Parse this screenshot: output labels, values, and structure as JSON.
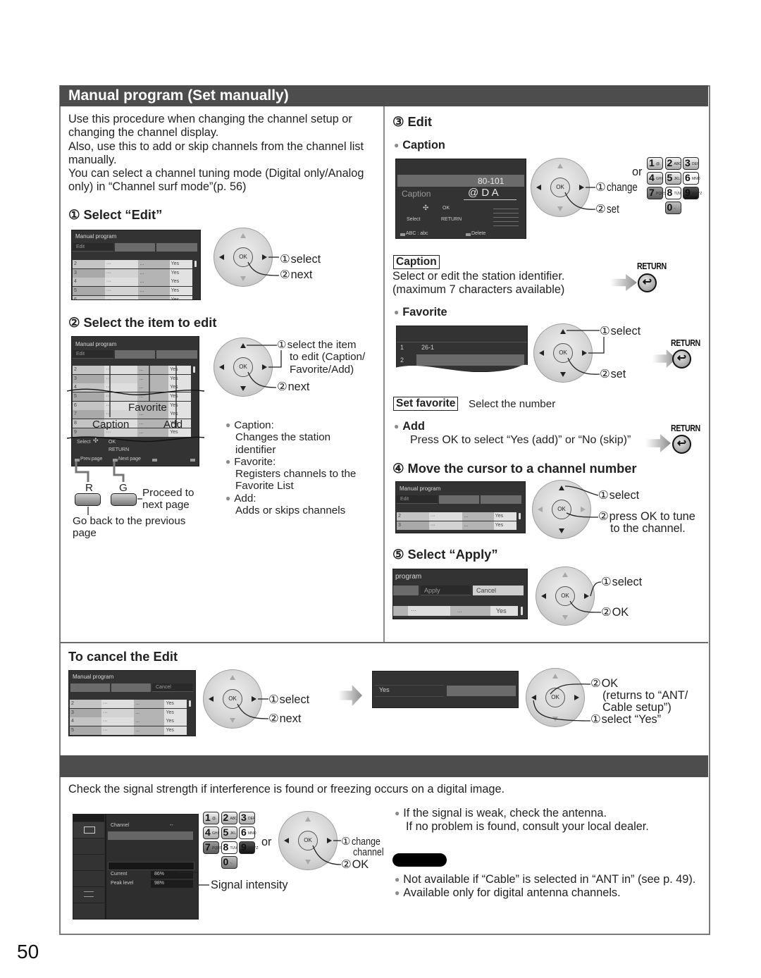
{
  "page_number": "50",
  "header": {
    "title": "Manual program (Set manually)"
  },
  "intro": {
    "lines": [
      "Use this procedure when changing the channel setup or",
      "changing the channel display.",
      "Also, use this to add or skip channels from the channel list",
      "manually.",
      "You can select a channel tuning mode (Digital only/Analog",
      "only) in “Channel surf mode”(p. 56)"
    ]
  },
  "remote": {
    "ok": "OK",
    "or": "or",
    "keys": [
      {
        "num": "1",
        "sub": "@."
      },
      {
        "num": "2",
        "sub": "ABC"
      },
      {
        "num": "3",
        "sub": "DEF"
      },
      {
        "num": "4",
        "sub": "GHI"
      },
      {
        "num": "5",
        "sub": "JKL"
      },
      {
        "num": "6",
        "sub": "MNO"
      },
      {
        "num": "7",
        "sub": "PQRS"
      },
      {
        "num": "8",
        "sub": "TUV"
      },
      {
        "num": "9",
        "sub": "WXYZ"
      },
      {
        "num": "0",
        "sub": "-."
      }
    ],
    "return_label": "RETURN",
    "return_glyph": "↩",
    "red_label": "R",
    "green_label": "G"
  },
  "step1": {
    "num": "①",
    "title": "Select “Edit”",
    "l1_num": "①",
    "l1": "select",
    "l2_num": "②",
    "l2": "next"
  },
  "step2": {
    "num": "②",
    "title": "Select the item to edit",
    "l1_num": "①",
    "l1_lines": [
      "select the item",
      "to edit (Caption/",
      "Favorite/Add)"
    ],
    "l2_num": "②",
    "l2": "next",
    "overlay": {
      "caption": "Caption",
      "favorite": "Favorite",
      "add": "Add"
    },
    "proceed_lines": [
      "Proceed to",
      "next page"
    ],
    "goback_lines": [
      "Go back to the previous",
      "page"
    ],
    "bullets": [
      {
        "term": "Caption:",
        "desc": [
          "Changes the station",
          "identifier"
        ]
      },
      {
        "term": "Favorite:",
        "desc": [
          "Registers channels to the",
          "Favorite List"
        ]
      },
      {
        "term": "Add:",
        "desc": [
          "Adds or skips channels"
        ]
      }
    ]
  },
  "step3": {
    "num": "③",
    "title": "Edit",
    "caption": {
      "heading": "Caption",
      "l1_num": "①",
      "l1": "change",
      "l2_num": "②",
      "l2": "set",
      "box_label": "Caption",
      "desc": [
        "Select or edit the station identifier.",
        "(maximum 7 characters available)"
      ]
    },
    "favorite": {
      "heading": "Favorite",
      "l1_num": "①",
      "l1": "select",
      "l2_num": "②",
      "l2": "set",
      "box_label": "Set favorite",
      "box_desc": "Select the number"
    },
    "add": {
      "heading": "Add",
      "desc": "Press OK to select “Yes (add)” or “No (skip)”"
    }
  },
  "step4": {
    "num": "④",
    "title": "Move the cursor to a channel number",
    "l1_num": "①",
    "l1": "select",
    "l2_num": "②",
    "l2_lines": [
      "press OK to tune",
      "to the channel."
    ]
  },
  "step5": {
    "num": "⑤",
    "title": "Select “Apply”",
    "l1_num": "①",
    "l1": "select",
    "l2_num": "②",
    "l2": "OK"
  },
  "cancel": {
    "title": "To cancel the Edit",
    "l1_num": "①",
    "l1": "select",
    "l2_num": "②",
    "l2": "next",
    "confirm": {
      "l2_num": "②",
      "l2": "OK",
      "l2_note": [
        "(returns to “ANT/",
        "Cable setup”)"
      ],
      "l1_num": "①",
      "l1": "select “Yes”"
    }
  },
  "signal": {
    "intro": "Check the signal strength if interference is found or freezing occurs on a digital image.",
    "l1_num": "①",
    "l1_lines": [
      "change",
      "channel"
    ],
    "l2_num": "②",
    "l2": "OK",
    "intensity_label": "Signal intensity",
    "tips": [
      "If the signal is weak, check the antenna.",
      "If no problem is found, consult your local dealer."
    ],
    "notes": [
      "Not available if “Cable” is selected in “ANT in” (see p. 49).",
      "Available only for digital antenna channels."
    ]
  },
  "screens": {
    "edit": {
      "title": "Manual program",
      "tabs": [
        "Edit",
        "",
        ""
      ],
      "rows": [
        [
          "2",
          "···",
          "...",
          "Yes"
        ],
        [
          "3",
          "···",
          "...",
          "Yes"
        ],
        [
          "4",
          "···",
          "...",
          "Yes"
        ],
        [
          "5",
          "···",
          "...",
          "Yes"
        ],
        [
          "6",
          "···",
          "...",
          "Yes"
        ]
      ]
    },
    "select_item": {
      "title": "Manual program",
      "tabs": [
        "Edit",
        "",
        ""
      ],
      "rows": [
        [
          "2",
          "···",
          "...",
          "Yes"
        ],
        [
          "3",
          "···",
          "...",
          "Yes"
        ],
        [
          "4",
          "···",
          "...",
          "Yes"
        ],
        [
          "5",
          "···",
          "...",
          "Yes"
        ],
        [
          "6",
          "···",
          "...",
          "Yes"
        ],
        [
          "7",
          "···",
          "...",
          "Yes"
        ],
        [
          "8",
          "···",
          "...",
          "Yes"
        ],
        [
          "9",
          "···",
          "...",
          "Yes"
        ]
      ],
      "hint_select": "Select",
      "hint_ok": "OK",
      "hint_return": "RETURN",
      "prev_page": "Prev.page",
      "next_page": "Next page"
    },
    "caption": {
      "channel": "80-101",
      "label": "Caption",
      "value": "@ D A",
      "hint_ok": "OK",
      "hint_select": "Select",
      "hint_return": "RETURN",
      "footer_abc": "ABC : abc",
      "footer_delete": "Delete"
    },
    "favorite": {
      "rows": [
        [
          "1",
          "26-1"
        ],
        [
          "2",
          ""
        ]
      ]
    },
    "move": {
      "title": "Manual program",
      "tabs": [
        "Edit",
        "",
        ""
      ],
      "rows": [
        [
          "2",
          "···",
          "...",
          "Yes"
        ],
        [
          "3",
          "···",
          "...",
          "Yes"
        ]
      ]
    },
    "apply": {
      "title": "program",
      "tabs": [
        "",
        "Apply",
        "Cancel"
      ],
      "row": [
        "",
        "···",
        "...",
        "Yes"
      ]
    },
    "cancel": {
      "title": "Manual program",
      "tabs": [
        ":",
        "",
        "Cancel"
      ],
      "rows": [
        [
          "2",
          "···",
          "...",
          "Yes"
        ],
        [
          "3",
          "···",
          "...",
          "Yes"
        ],
        [
          "4",
          "···",
          "...",
          "Yes"
        ],
        [
          "5",
          "···",
          "...",
          "Yes"
        ]
      ]
    },
    "confirm": {
      "option": "Yes"
    },
    "signal": {
      "channel_label": "Channel",
      "channel_value": "--",
      "current_label": "Current",
      "current_value": "86%",
      "peak_label": "Peak level",
      "peak_value": "98%"
    }
  }
}
